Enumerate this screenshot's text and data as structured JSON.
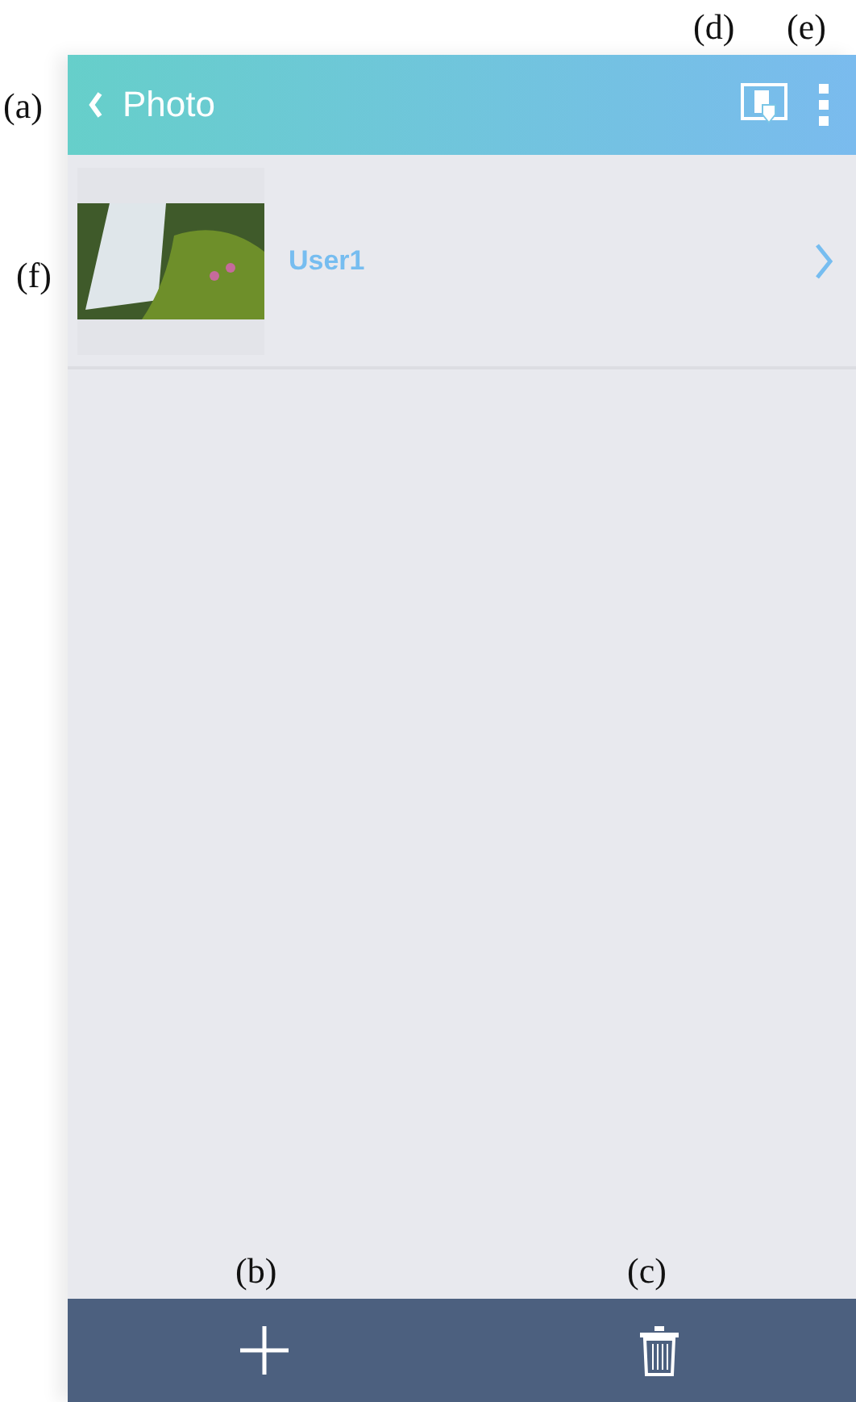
{
  "header": {
    "title": "Photo"
  },
  "items": [
    {
      "name": "User1"
    }
  ],
  "annotations": {
    "back": "(a)",
    "add": "(b)",
    "delete": "(c)",
    "export": "(d)",
    "menu": "(e)",
    "photo": "(f)"
  }
}
